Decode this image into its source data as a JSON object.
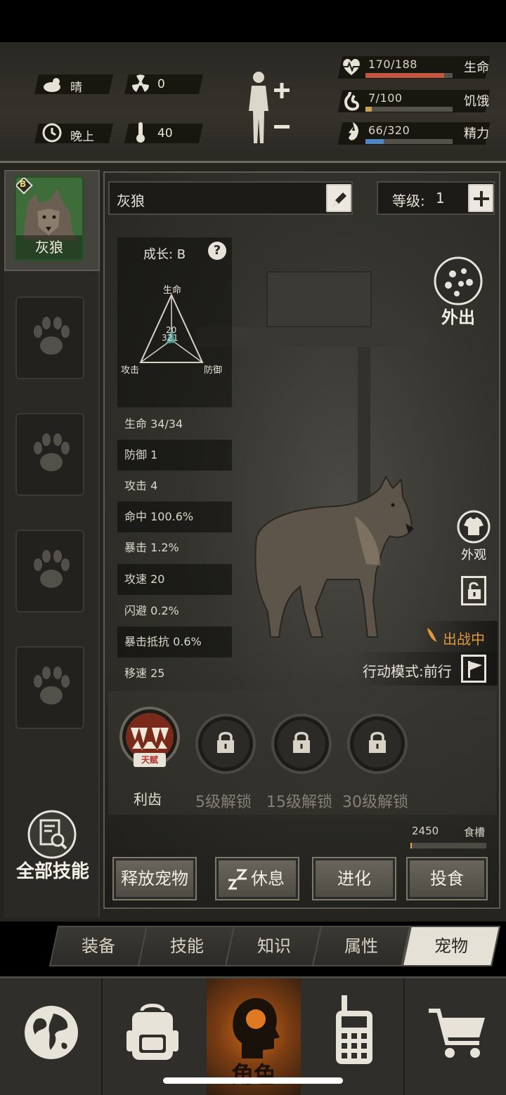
{
  "hud": {
    "weather": "晴",
    "radiation": "0",
    "time_of_day": "晚上",
    "temperature": "40",
    "health": {
      "label": "生命",
      "value": "170/188",
      "fraction": 0.904,
      "color": "#c2563e"
    },
    "hunger": {
      "label": "饥饿",
      "value": "7/100",
      "fraction": 0.07,
      "color": "#c9a34a"
    },
    "energy": {
      "label": "精力",
      "value": "66/320",
      "fraction": 0.206,
      "color": "#4f86c6"
    }
  },
  "sidebar": {
    "active_pet": {
      "name": "灰狼",
      "grade": "B"
    },
    "all_skills_label": "全部技能"
  },
  "pet": {
    "name": "灰狼",
    "level_label": "等级:",
    "level_value": "1",
    "growth_label": "成长: B",
    "radar": {
      "top": "生命",
      "left": "攻击",
      "right": "防御",
      "values": [
        "20",
        "32",
        "1"
      ]
    },
    "go_out_label": "外出",
    "appearance_label": "外观",
    "status_label": "出战中",
    "action_mode_label": "行动模式:前行"
  },
  "attributes": [
    {
      "label": "生命 34/34"
    },
    {
      "label": "防御 1"
    },
    {
      "label": "攻击 4"
    },
    {
      "label": "命中 100.6%"
    },
    {
      "label": "暴击 1.2%"
    },
    {
      "label": "攻速 20"
    },
    {
      "label": "闪避 0.2%"
    },
    {
      "label": "暴击抵抗 0.6%"
    },
    {
      "label": "移速 25"
    }
  ],
  "skills": [
    {
      "label": "利齿",
      "badge": "天赋"
    },
    {
      "label": "5级解锁"
    },
    {
      "label": "15级解锁"
    },
    {
      "label": "30级解锁"
    }
  ],
  "food": {
    "value": "2450",
    "label": "食槽",
    "fraction": 0.02
  },
  "actions": {
    "release": "释放宠物",
    "rest": "休息",
    "evolve": "进化",
    "feed": "投食"
  },
  "tabs": [
    "装备",
    "技能",
    "知识",
    "属性",
    "宠物"
  ],
  "bottom_nav": {
    "character_label": "角色"
  },
  "colors": {
    "accent_orange": "#e0993a",
    "health_bar": "#c2563e",
    "hunger_bar": "#c9a34a",
    "energy_bar": "#4f86c6"
  }
}
